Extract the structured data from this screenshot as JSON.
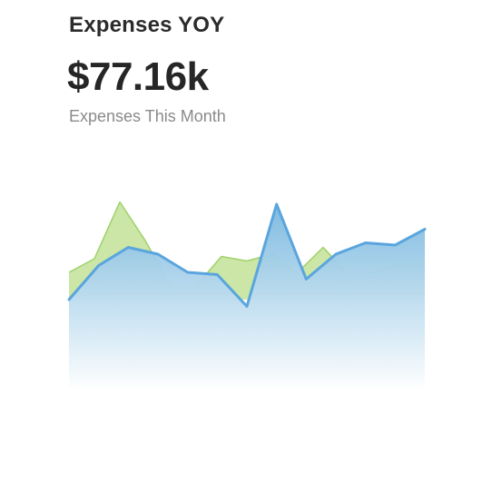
{
  "widget": {
    "title": "Expenses YOY",
    "value": "$77.16k",
    "subtitle": "Expenses This Month"
  },
  "colors": {
    "current_line": "#5aa5de",
    "current_fill_top": "#79b8df",
    "current_fill_bottom": "#ffffff",
    "previous_fill": "#c5e39c",
    "previous_line": "#9fd16a"
  },
  "chart_data": {
    "type": "area",
    "title": "",
    "xlabel": "",
    "ylabel": "",
    "grid": false,
    "legend": "none",
    "ylim": [
      0,
      100
    ],
    "x": [
      0,
      1,
      2,
      3,
      4,
      5,
      6,
      7,
      8,
      9,
      10,
      11,
      12,
      13,
      14
    ],
    "series": [
      {
        "id": "previous",
        "values": [
          52,
          58,
          83,
          66,
          46,
          46,
          59,
          57,
          60,
          52,
          63,
          51,
          52,
          56,
          57
        ]
      },
      {
        "id": "current",
        "values": [
          40,
          55,
          63,
          60,
          52,
          51,
          37,
          82,
          49,
          60,
          65,
          64,
          71
        ]
      }
    ]
  }
}
